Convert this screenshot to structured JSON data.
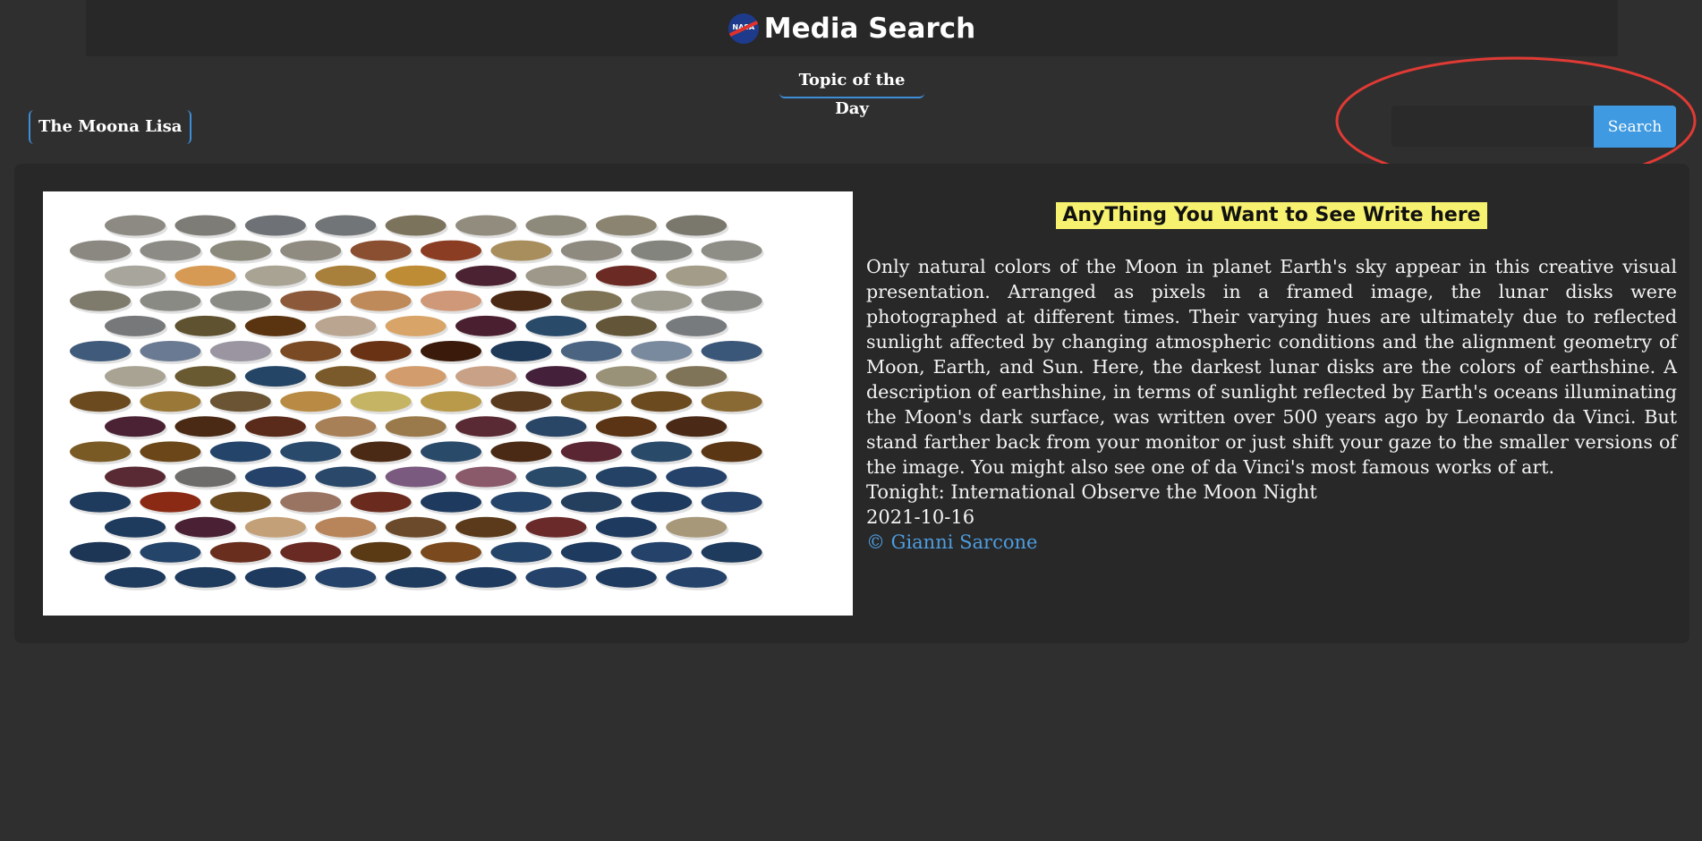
{
  "header": {
    "logo_text": "NASA",
    "title": "Media Search"
  },
  "nav": {
    "topic_tab": "Topic of the Day",
    "topic_button": "The Moona Lisa"
  },
  "search": {
    "value": "",
    "placeholder": "",
    "button_label": "Search"
  },
  "colors": {
    "accent": "#3f9ae1",
    "headline_bg": "#f6f16e",
    "annotation": "#e03a34",
    "card_bg": "#282828",
    "page_bg": "#2f2f2f"
  },
  "result": {
    "headline": "AnyThing You  Want to See Write here",
    "description": "Only natural colors of the Moon in planet Earth's sky appear in this creative visual presentation. Arranged as pixels in a framed image, the lunar disks were photographed at different times. Their varying hues are ultimately due to reflected sunlight affected by changing atmospheric conditions and the alignment geometry of Moon, Earth, and Sun. Here, the darkest lunar disks are the colors of earthshine. A description of earthshine, in terms of sunlight reflected by Earth's oceans illuminating the Moon's dark surface, was written over 500 years ago by Leonardo da Vinci. But stand farther back from your monitor or just shift your gaze to the smaller versions of the image. You might also see one of da Vinci's most famous works of art.",
    "tonight": "Tonight: International Observe the Moon Night",
    "date": "2021-10-16",
    "credit": "© Gianni Sarcone"
  },
  "image": {
    "subject": "grid of lunar disks in natural colors",
    "rows": [
      [
        "#8d8a83",
        "#7d7c76",
        "#6e7276",
        "#727577",
        "#7c735d",
        "#918c7d",
        "#8e8a7b",
        "#8a8470",
        "#7a776d"
      ],
      [
        "#8a8881",
        "#8c8b85",
        "#8b887c",
        "#8f8b80",
        "#8a4e30",
        "#8a3d22",
        "#a88e5c",
        "#8f8a80",
        "#84847e",
        "#8e8d86"
      ],
      [
        "#a8a69c",
        "#d69a54",
        "#a9a394",
        "#a87f3b",
        "#bd8c35",
        "#4a2232",
        "#9d9889",
        "#6c2a24",
        "#a39c88"
      ],
      [
        "#7e7a6c",
        "#8a8a85",
        "#8b8b86",
        "#8c5a3a",
        "#bf8a5a",
        "#cf9878",
        "#4a2a14",
        "#7e7355",
        "#9d9a8e",
        "#8a8a86"
      ],
      [
        "#77787a",
        "#5f5230",
        "#5a3410",
        "#b9a590",
        "#d8a468",
        "#4a2030",
        "#2a4a6a",
        "#625538",
        "#777b7e"
      ],
      [
        "#3f5a7a",
        "#6a7a92",
        "#9a95a0",
        "#7a4a24",
        "#6a3214",
        "#3a1a0a",
        "#1e3a58",
        "#4a6482",
        "#7a8a9e",
        "#3a5678"
      ],
      [
        "#a8a392",
        "#6a5a32",
        "#244566",
        "#7a5a2a",
        "#d29c6c",
        "#c9a186",
        "#44203a",
        "#9a9278",
        "#807458"
      ],
      [
        "#6a4a1e",
        "#9a7838",
        "#6a5434",
        "#b88a44",
        "#c4b464",
        "#b89a4a",
        "#5a3a1e",
        "#7a5c2a",
        "#6a4a1e",
        "#8a6a34"
      ],
      [
        "#4a2234",
        "#4a2a14",
        "#5a2a1a",
        "#a88058",
        "#9a7a4a",
        "#5a2a34",
        "#2a4666",
        "#5a3414",
        "#4a2a16"
      ],
      [
        "#7a5a24",
        "#6a4618",
        "#24446a",
        "#2a4a6c",
        "#4a2a14",
        "#2a4a6a",
        "#4a2a14",
        "#5a2634",
        "#2a4a6a",
        "#5a3614"
      ],
      [
        "#5a2a34",
        "#6e6c6a",
        "#24426a",
        "#2a486a",
        "#7a5a7e",
        "#8a5a6a",
        "#2a4a6a",
        "#244266",
        "#24426a"
      ],
      [
        "#1e3a5c",
        "#8a2a14",
        "#6a4a1e",
        "#9a7462",
        "#6a2a1e",
        "#1e3a5e",
        "#24446a",
        "#243e5e",
        "#1e3a5e",
        "#24426a"
      ],
      [
        "#1e3a5c",
        "#4a2034",
        "#c4a078",
        "#b8845a",
        "#6a4a2a",
        "#5a3a1a",
        "#6a2a2a",
        "#1e3a5e",
        "#a8987a"
      ],
      [
        "#1e3656",
        "#24446a",
        "#6a2e1e",
        "#6a2a24",
        "#5a3a14",
        "#7a4a1e",
        "#24446a",
        "#1e3a5e",
        "#24426a",
        "#1e3a5c"
      ],
      [
        "#1e3a5c",
        "#1e3a5c",
        "#1e3a5e",
        "#24426a",
        "#1e3a5c",
        "#1e3a5e",
        "#24426a",
        "#1e3a5e",
        "#24426a"
      ]
    ]
  }
}
